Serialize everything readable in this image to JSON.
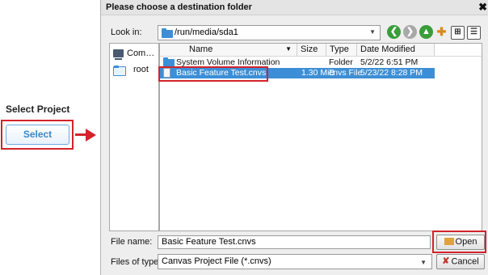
{
  "left_panel": {
    "title": "Select Project",
    "select_button": "Select"
  },
  "dialog": {
    "title": "Please choose a destination folder",
    "close_icon": "close-icon",
    "look_in_label": "Look in:",
    "look_in_value": "/run/media/sda1",
    "toolbar": [
      "back-icon",
      "forward-icon",
      "up-folder-icon",
      "new-folder-icon",
      "details-view-icon",
      "list-view-icon"
    ],
    "places": [
      {
        "label": "Com…",
        "icon": "computer-icon"
      },
      {
        "label": "root",
        "icon": "folder-icon"
      }
    ],
    "columns": [
      "Name",
      "Size",
      "Type",
      "Date Modified"
    ],
    "files": [
      {
        "name": "System Volume Information",
        "size": "",
        "type": "Folder",
        "modified": "5/2/22 6:51 PM",
        "selected": false,
        "icon": "folder-icon"
      },
      {
        "name": "Basic Feature Test.cnvs",
        "size": "1.30 MiB",
        "type": "cnvs File",
        "modified": "5/23/22 8:28 PM",
        "selected": true,
        "icon": "document-icon"
      }
    ],
    "file_name_label": "File name:",
    "file_name_value": "Basic Feature Test.cnvs",
    "files_of_type_label": "Files of type:",
    "files_of_type_value": "Canvas Project File (*.cnvs)",
    "open_button": "Open",
    "cancel_button": "Cancel"
  },
  "colors": {
    "highlight_red": "#d3232b",
    "selection_blue": "#3c8fd6",
    "select_button_text": "#3a87c8"
  }
}
